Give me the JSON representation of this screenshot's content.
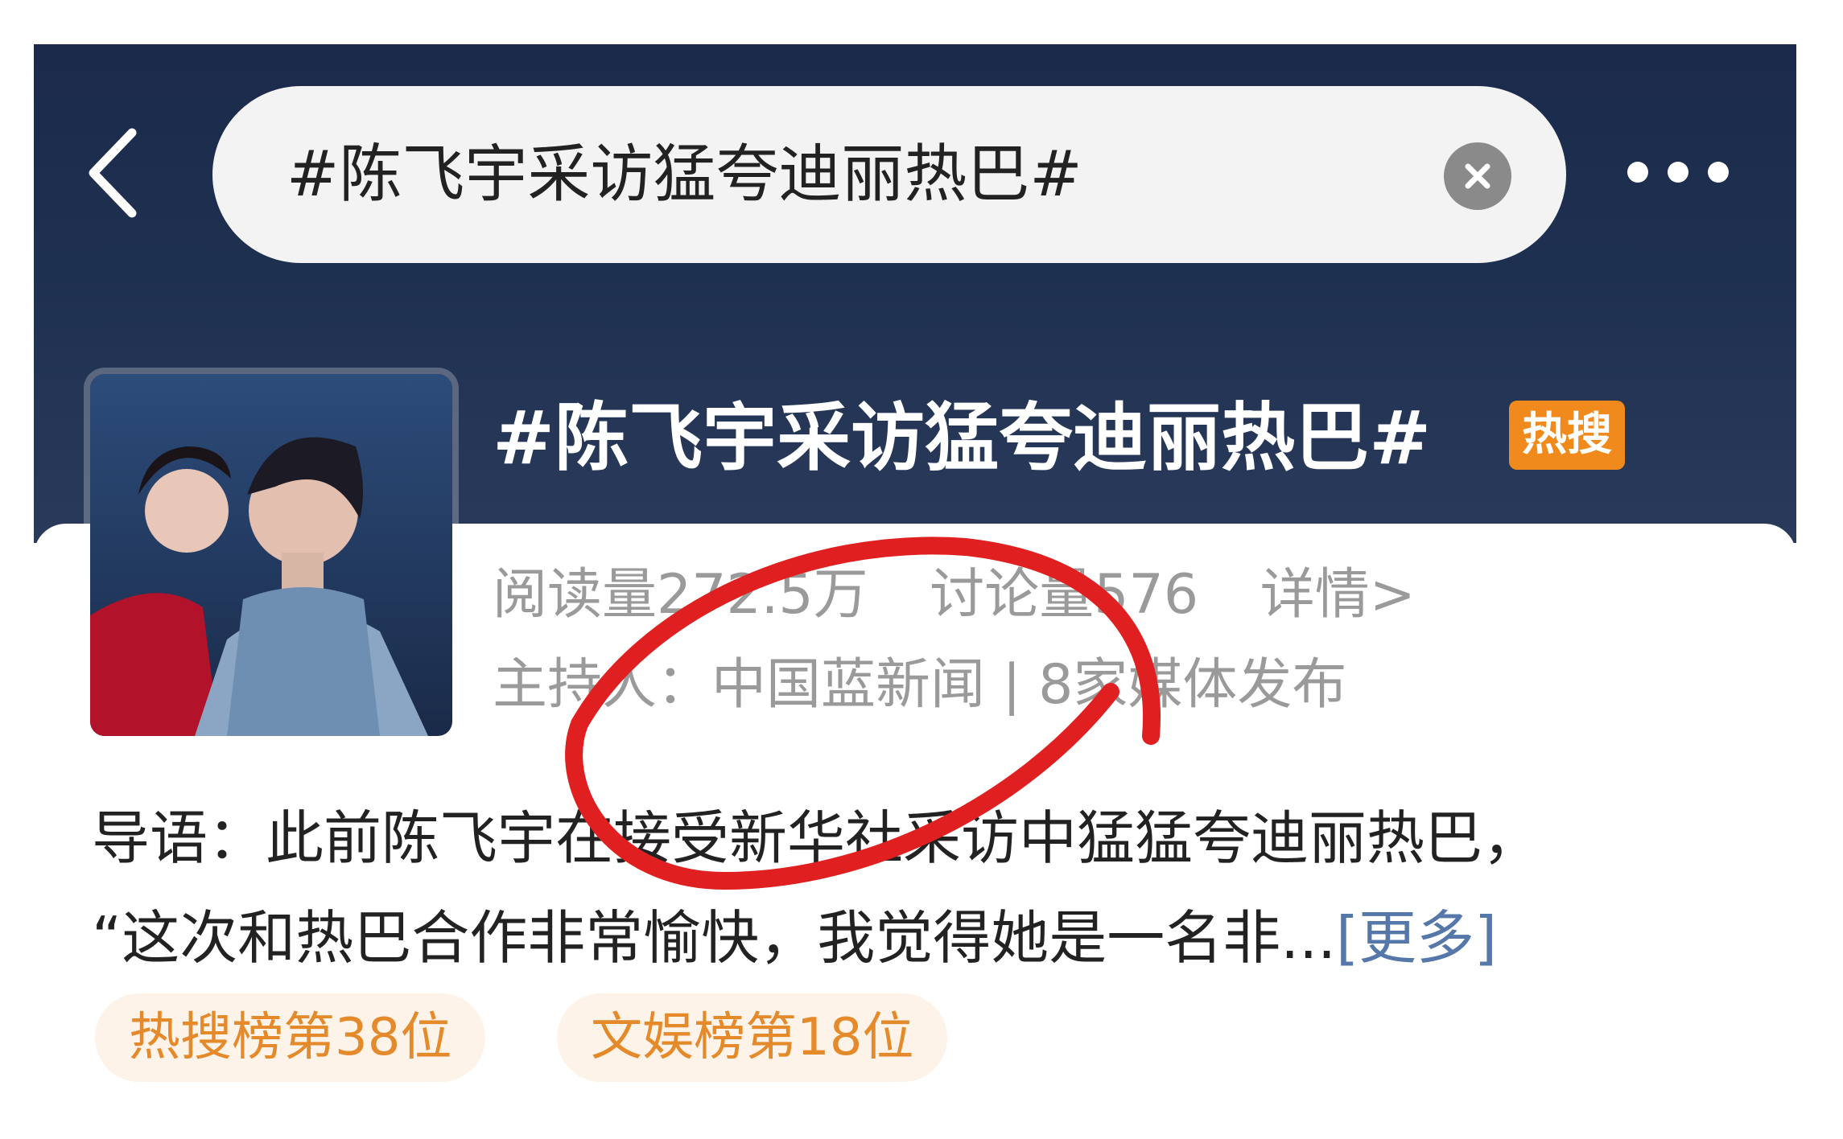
{
  "search": {
    "query": "#陈飞宇采访猛夸迪丽热巴#"
  },
  "topic": {
    "title": "#陈飞宇采访猛夸迪丽热巴#",
    "badge": "热搜",
    "reads": "阅读量272.5万",
    "discussions": "讨论量576",
    "details_link": "详情>",
    "host": "主持人：中国蓝新闻 | 8家媒体发布"
  },
  "intro": {
    "line1": "导语：此前陈飞宇在接受新华社采访中猛猛夸迪丽热巴，",
    "line2": "“这次和热巴合作非常愉快，我觉得她是一名非...",
    "more": "[更多]"
  },
  "ranks": [
    {
      "label": "热搜榜第38位"
    },
    {
      "label": "文娱榜第18位"
    }
  ],
  "icons": {
    "back": "chevron-left-icon",
    "clear": "close-circle-icon",
    "more": "more-dots-icon"
  },
  "colors": {
    "header_bg": "#1b2a4a",
    "badge": "#f08a1c",
    "rank_text": "#e58a2b",
    "rank_bg": "#fdf3e8",
    "more_link": "#5577aa",
    "annotation_circle": "#e02020"
  }
}
